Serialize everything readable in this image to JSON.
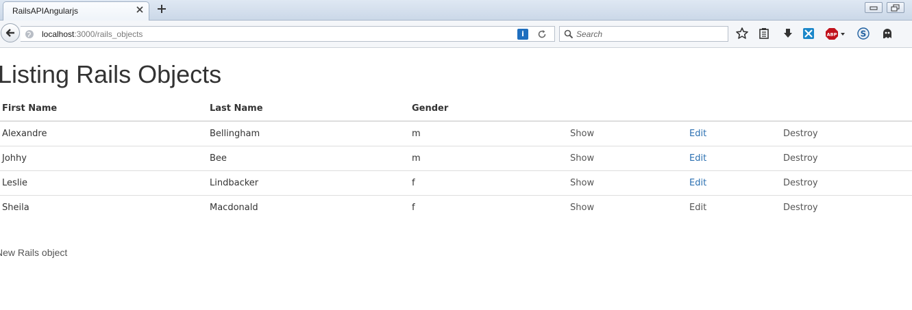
{
  "browser": {
    "tab_title": "RailsAPIAngularjs",
    "url_host": "localhost",
    "url_path": ":3000/rails_objects",
    "search_placeholder": "Search",
    "info_label": "i",
    "icons": [
      "back-arrow-icon",
      "globe-icon",
      "info-icon",
      "reload-icon",
      "search-icon",
      "bookmark-star-icon",
      "reading-list-icon",
      "download-icon",
      "extension-icon",
      "adblock-icon",
      "skype-icon",
      "ghostery-icon"
    ]
  },
  "page": {
    "title": "Listing Rails Objects",
    "columns": [
      "First Name",
      "Last Name",
      "Gender"
    ],
    "rows": [
      {
        "first_name": "Alexandre",
        "last_name": "Bellingham",
        "gender": "m",
        "show": "Show",
        "edit": "Edit",
        "destroy": "Destroy"
      },
      {
        "first_name": "Johhy",
        "last_name": "Bee",
        "gender": "m",
        "show": "Show",
        "edit": "Edit",
        "destroy": "Destroy"
      },
      {
        "first_name": "Leslie",
        "last_name": "Lindbacker",
        "gender": "f",
        "show": "Show",
        "edit": "Edit",
        "destroy": "Destroy"
      },
      {
        "first_name": "Sheila",
        "last_name": "Macdonald",
        "gender": "f",
        "show": "Show",
        "edit": "Edit",
        "destroy": "Destroy"
      }
    ],
    "new_link": "New Rails object"
  },
  "colors": {
    "link_blue": "#2a6fb1",
    "link_gray": "#555555",
    "text": "#333333",
    "rule": "#dddddd"
  }
}
